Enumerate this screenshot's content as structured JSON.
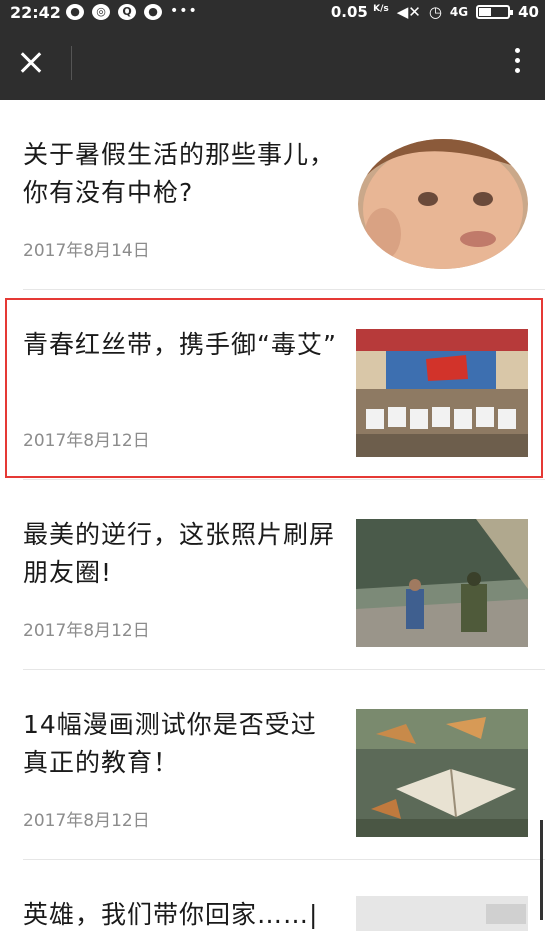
{
  "status_bar": {
    "time": "22:42",
    "speed": "0.05",
    "speed_unit": "K/s",
    "network": "4G",
    "battery_level": "40"
  },
  "nav": {
    "close_icon": "close-icon",
    "more_icon": "more-vertical-icon"
  },
  "articles": [
    {
      "title": "关于暑假生活的那些事儿，你有没有中枪?",
      "date": "2017年8月14日",
      "thumb": "crying-baby-photo",
      "highlighted": false
    },
    {
      "title": "青春红丝带，携手御“毒艾”",
      "date": "2017年8月12日",
      "thumb": "group-photo",
      "highlighted": true
    },
    {
      "title": "最美的逆行，这张照片刷屏朋友圈!",
      "date": "2017年8月12日",
      "thumb": "rescue-photo",
      "highlighted": false
    },
    {
      "title": "14幅漫画测试你是否受过真正的教育！",
      "date": "2017年8月12日",
      "thumb": "open-book-photo",
      "highlighted": false
    },
    {
      "title": "英雄，我们带你回家……|",
      "date": "",
      "thumb": "partial-photo",
      "highlighted": false
    }
  ],
  "colors": {
    "bar": "#2e2e2e",
    "highlight": "#e53935",
    "date": "#8c8c8c"
  }
}
